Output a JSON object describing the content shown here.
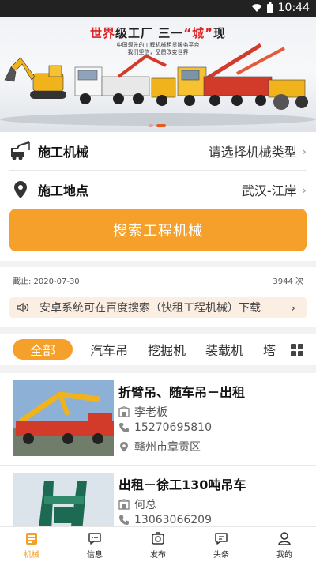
{
  "status_bar": {
    "time": "10:44"
  },
  "banner": {
    "title_red": "世界",
    "title_black": "级工厂  三一",
    "title_red_quote": "“城”",
    "title_end": "现",
    "subtitle_1": "中国领先的工程机械租赁服务平台",
    "subtitle_2": "我们坚信，品质改变世界"
  },
  "form": {
    "machine_label": "施工机械",
    "machine_value": "请选择机械类型",
    "location_label": "施工地点",
    "location_value": "武汉-江岸",
    "search_button": "搜索工程机械"
  },
  "stats": {
    "date_text": "截止: 2020-07-30",
    "count_text": "3944 次"
  },
  "notice": {
    "text": "安卓系统可在百度搜索（快租工程机械）下载"
  },
  "tabs": {
    "items": [
      "全部",
      "汽车吊",
      "挖掘机",
      "装载机",
      "塔"
    ],
    "active_index": 0
  },
  "listings": [
    {
      "title": "折臂吊、随车吊－出租",
      "contact": "李老板",
      "phone": "15270695810",
      "location": "赣州市章贡区"
    },
    {
      "title": "出租－徐工130吨吊车",
      "contact": "何总",
      "phone": "13063066209",
      "location": ""
    }
  ],
  "bottom_nav": {
    "items": [
      "机械",
      "信息",
      "发布",
      "头条",
      "我的"
    ],
    "active_index": 0
  },
  "colors": {
    "accent": "#f5a02a",
    "notice_bg": "#fbeee2",
    "banner_red": "#d22222"
  }
}
